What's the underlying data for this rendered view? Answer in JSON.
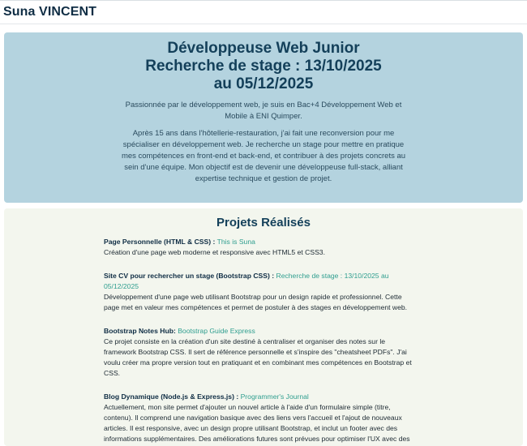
{
  "header": {
    "brand": "Suna VINCENT"
  },
  "hero": {
    "title_line1": "Développeuse Web Junior",
    "title_line2": "Recherche de stage : 13/10/2025",
    "title_line3": "au 05/12/2025",
    "intro": "Passionnée par le développement web, je suis en Bac+4 Développement Web et Mobile à ENI Quimper.",
    "about": "Après 15 ans dans l'hôtellerie-restauration, j'ai fait une reconversion pour me spécialiser en développement web. Je recherche un stage pour mettre en pratique mes compétences en front-end et back-end, et contribuer à des projets concrets au sein d'une équipe. Mon objectif est de devenir une développeuse full-stack, alliant expertise technique et gestion de projet."
  },
  "projects": {
    "title": "Projets Réalisés",
    "items": [
      {
        "name": "Page Personnelle (HTML & CSS) :",
        "link": "This is Suna",
        "description": "Création d'une page web moderne et responsive avec HTML5 et CSS3."
      },
      {
        "name": "Site CV pour rechercher un stage (Bootstrap CSS) :",
        "link": "Recherche de stage : 13/10/2025 au 05/12/2025",
        "description": "Développement d'une page web utilisant Bootstrap pour un design rapide et professionnel. Cette page met en valeur mes compétences et permet de postuler à des stages en développement web."
      },
      {
        "name": "Bootstrap Notes Hub:",
        "link": "Bootstrap Guide Express",
        "description": "Ce projet consiste en la création d'un site destiné à centraliser et organiser des notes sur le framework Bootstrap CSS. Il sert de référence personnelle et s'inspire des \"cheatsheet PDFs\". J'ai voulu créer ma propre version tout en pratiquant et en combinant mes compétences en Bootstrap et CSS."
      },
      {
        "name": "Blog Dynamique (Node.js & Express.js) :",
        "link": "Programmer's Journal",
        "description": "Actuellement, mon site permet d'ajouter un nouvel article à l'aide d'un formulaire simple (titre, contenu). Il comprend une navigation basique avec des liens vers l'accueil et l'ajout de nouveaux articles. Il est responsive, avec un design propre utilisant Bootstrap, et inclut un footer avec des informations supplémentaires. Des améliorations futures sont prévues pour optimiser l'UX avec des fonctionnalités comme la recherche, la pagination, et les commentaires. Le design sera modernisé avec un mode sombre, des animations, et la connexion du back-end à une base de données."
      }
    ]
  }
}
